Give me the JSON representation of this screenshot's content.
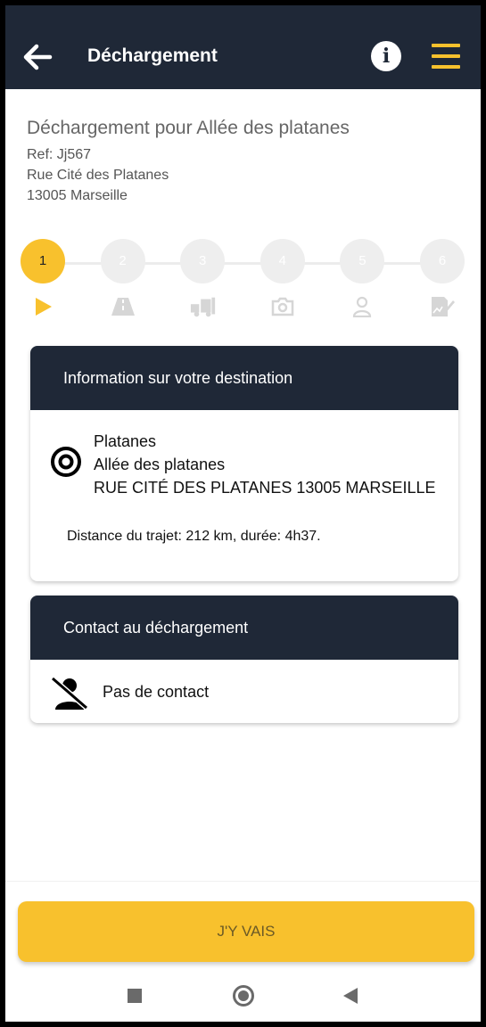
{
  "appbar": {
    "title": "Déchargement",
    "back_icon": "arrow-left-icon",
    "info_icon": "info-icon",
    "menu_icon": "hamburger-menu-icon",
    "info_glyph": "i"
  },
  "header": {
    "title": "Déchargement pour Allée des platanes",
    "ref": "Ref: Jj567",
    "street": "Rue Cité des Platanes",
    "city": "13005 Marseille"
  },
  "stepper": {
    "current_step": 1,
    "steps": [
      {
        "label": "1",
        "icon": "play-icon"
      },
      {
        "label": "2",
        "icon": "road-icon"
      },
      {
        "label": "3",
        "icon": "truck-unload-icon"
      },
      {
        "label": "4",
        "icon": "camera-icon"
      },
      {
        "label": "5",
        "icon": "person-icon"
      },
      {
        "label": "6",
        "icon": "signature-icon"
      }
    ]
  },
  "destination_card": {
    "heading": "Information sur votre destination",
    "name": "Platanes",
    "address_line1": "Allée des platanes",
    "address_line2": "RUE CITÉ DES PLATANES 13005 MARSEILLE",
    "distance": "Distance du trajet: 212 km, durée: 4h37."
  },
  "contact_card": {
    "heading": "Contact au déchargement",
    "value": "Pas de contact"
  },
  "cta": {
    "label": "J'Y VAIS"
  },
  "colors": {
    "navy": "#1f2837",
    "accent": "#f8c12d",
    "inactive_step": "#eeeeee"
  }
}
